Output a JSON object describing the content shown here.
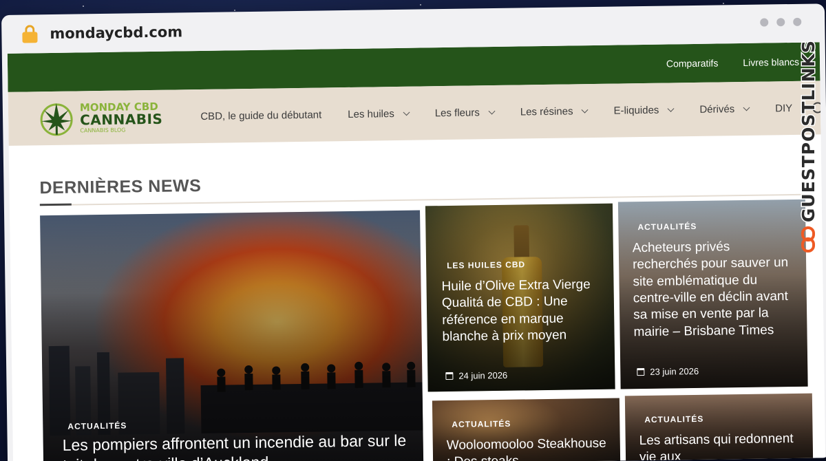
{
  "browser": {
    "url": "mondaycbd.com"
  },
  "site": {
    "top_links": [
      "Comparatifs",
      "Livres blancs"
    ],
    "logo": {
      "line1": "MONDAY CBD",
      "line2": "CANNABIS",
      "line3": "CANNABIS BLOG"
    },
    "menu": [
      {
        "label": "CBD, le guide du débutant",
        "has_dropdown": false
      },
      {
        "label": "Les huiles",
        "has_dropdown": true
      },
      {
        "label": "Les fleurs",
        "has_dropdown": true
      },
      {
        "label": "Les résines",
        "has_dropdown": true
      },
      {
        "label": "E-liquides",
        "has_dropdown": true
      },
      {
        "label": "Dérivés",
        "has_dropdown": true
      },
      {
        "label": "DIY",
        "has_dropdown": false
      }
    ],
    "section_title": "DERNIÈRES NEWS",
    "cards": [
      {
        "category": "ACTUALITÉS",
        "title": "Les pompiers affrontent un incendie au bar sur le toit du centre-ville d’Auckland –",
        "date": ""
      },
      {
        "category": "LES HUILES CBD",
        "title": "Huile d’Olive Extra Vierge Qualitá de CBD : Une référence en marque blanche à prix moyen",
        "date": "24 juin 2026"
      },
      {
        "category": "ACTUALITÉS",
        "title": "Acheteurs privés recherchés pour sauver un site emblématique du centre-ville en déclin avant sa mise en vente par la mairie – Brisbane Times",
        "date": "23 juin 2026"
      },
      {
        "category": "ACTUALITÉS",
        "title": "Wooloomooloo Steakhouse : Des steaks",
        "date": ""
      },
      {
        "category": "ACTUALITÉS",
        "title": "Les artisans qui redonnent vie aux",
        "date": ""
      }
    ]
  },
  "watermark": {
    "text": "GUESTPOSTLINKS"
  }
}
